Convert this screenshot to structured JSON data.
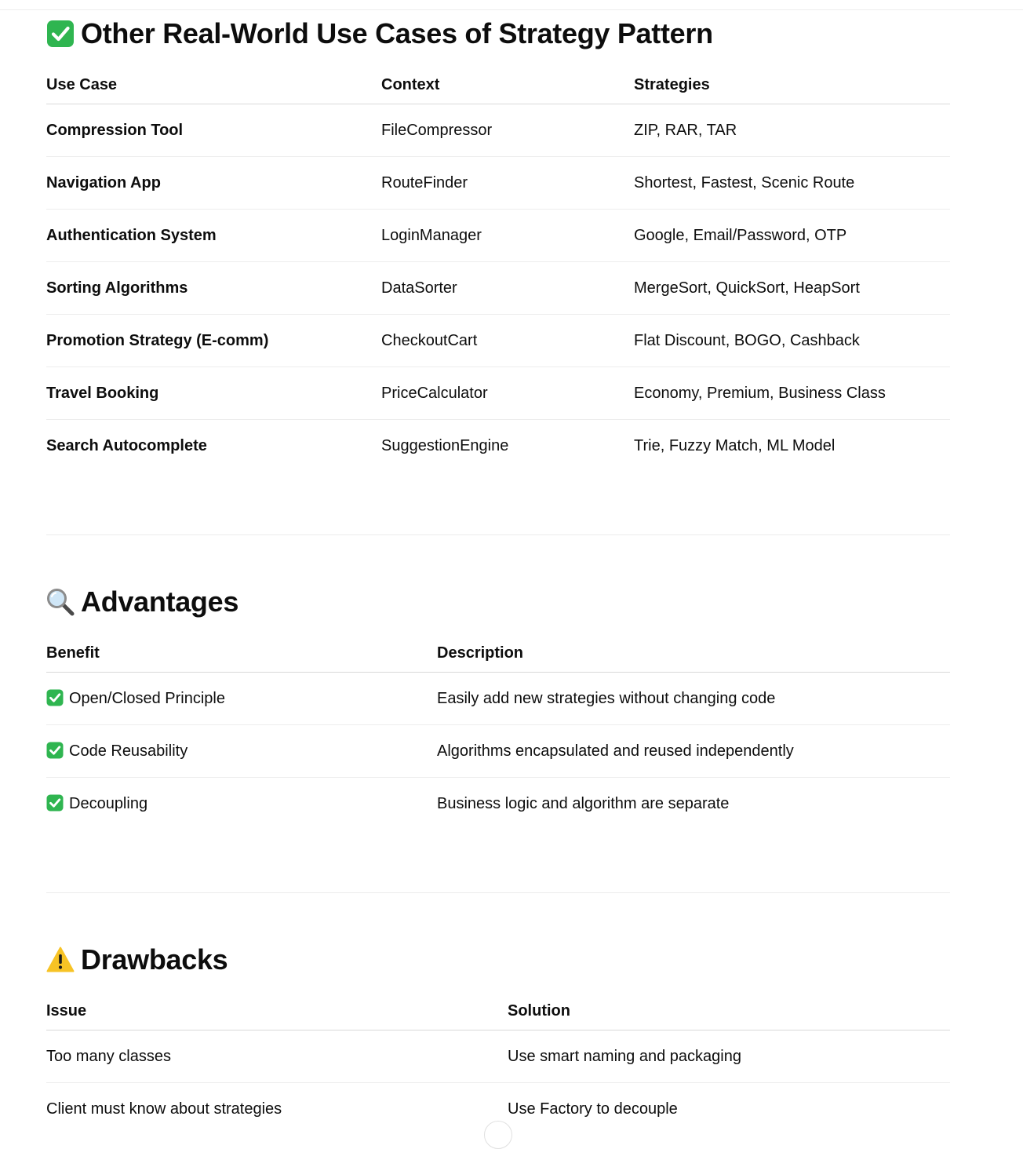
{
  "sections": {
    "use_cases": {
      "icon": "check-mark-button-icon",
      "title": "Other Real-World Use Cases of Strategy Pattern",
      "headers": [
        "Use Case",
        "Context",
        "Strategies"
      ],
      "rows": [
        [
          "Compression Tool",
          "FileCompressor",
          "ZIP, RAR, TAR"
        ],
        [
          "Navigation App",
          "RouteFinder",
          "Shortest, Fastest, Scenic Route"
        ],
        [
          "Authentication System",
          "LoginManager",
          "Google, Email/Password, OTP"
        ],
        [
          "Sorting Algorithms",
          "DataSorter",
          "MergeSort, QuickSort, HeapSort"
        ],
        [
          "Promotion Strategy (E-comm)",
          "CheckoutCart",
          "Flat Discount, BOGO, Cashback"
        ],
        [
          "Travel Booking",
          "PriceCalculator",
          "Economy, Premium, Business Class"
        ],
        [
          "Search Autocomplete",
          "SuggestionEngine",
          "Trie, Fuzzy Match, ML Model"
        ]
      ]
    },
    "advantages": {
      "icon": "magnifying-glass-icon",
      "title": "Advantages",
      "headers": [
        "Benefit",
        "Description"
      ],
      "rows": [
        [
          "Open/Closed Principle",
          "Easily add new strategies without changing code"
        ],
        [
          "Code Reusability",
          "Algorithms encapsulated and reused independently"
        ],
        [
          "Decoupling",
          "Business logic and algorithm are separate"
        ]
      ]
    },
    "drawbacks": {
      "icon": "warning-icon",
      "title": "Drawbacks",
      "headers": [
        "Issue",
        "Solution"
      ],
      "rows": [
        [
          "Too many classes",
          "Use smart naming and packaging"
        ],
        [
          "Client must know about strategies",
          "Use Factory to decouple"
        ]
      ]
    }
  },
  "colors": {
    "text": "#0d0d0d",
    "check_green": "#2fb550",
    "warning_yellow": "#f7c325",
    "rule": "#d9d9d9"
  }
}
